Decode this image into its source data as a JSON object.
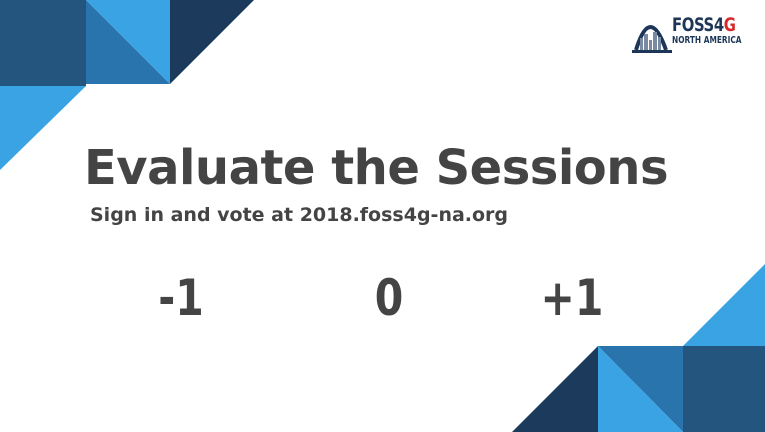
{
  "slide": {
    "title": "Evaluate the Sessions",
    "subtitle": "Sign in and vote at 2018.foss4g-na.org"
  },
  "logo": {
    "line1_main": "FOSS4",
    "line1_accent": "G",
    "line2": "NORTH AMERICA"
  },
  "vote_options": [
    "-1",
    "0",
    "+1"
  ],
  "colors": {
    "text": "#444444",
    "dark_navy": "#1b3a5c",
    "mid_blue": "#2e78b0",
    "light_blue": "#3aa3e3",
    "logo_red": "#d62828"
  }
}
